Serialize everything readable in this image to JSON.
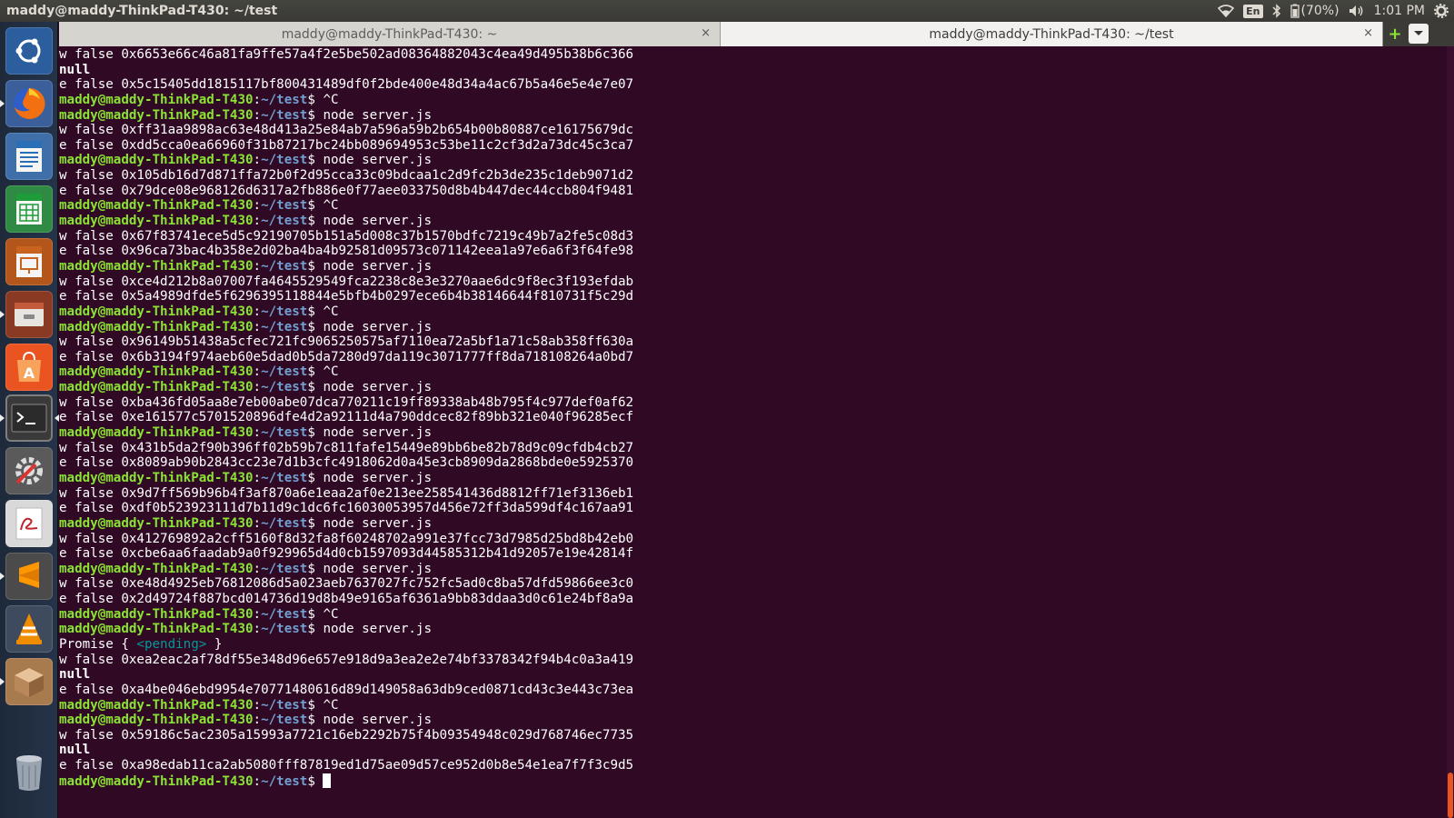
{
  "panel": {
    "title": "maddy@maddy-ThinkPad-T430: ~/test",
    "lang": "En",
    "battery": "(70%)",
    "time": "1:01 PM"
  },
  "tabs": [
    {
      "label": "maddy@maddy-ThinkPad-T430: ~",
      "close": "×"
    },
    {
      "label": "maddy@maddy-ThinkPad-T430: ~/test",
      "close": "×"
    }
  ],
  "prompt": {
    "user": "maddy@maddy-ThinkPad-T430",
    "path": "~/test",
    "symbol": "$"
  },
  "terminal_lines": [
    {
      "type": "out",
      "text": "w false 0x6653e66c46a81fa9ffe57a4f2e5be502ad08364882043c4ea49d495b38b6c366"
    },
    {
      "type": "bold",
      "text": "null"
    },
    {
      "type": "out",
      "text": "e false 0x5c15405dd1815117bf800431489df0f2bde400e48d34a4ac67b5a46e5e4e7e07"
    },
    {
      "type": "prompt",
      "cmd": "^C"
    },
    {
      "type": "prompt",
      "cmd": "node server.js"
    },
    {
      "type": "out",
      "text": "w false 0xff31aa9898ac63e48d413a25e84ab7a596a59b2b654b00b80887ce16175679dc"
    },
    {
      "type": "out",
      "text": "e false 0xdd5cca0ea66960f31b87217bc24bb089694953c53be11c2cf3d2a73dc45c3ca7"
    },
    {
      "type": "prompt",
      "cmd": "node server.js"
    },
    {
      "type": "out",
      "text": "w false 0x105db16d7d871ffa72b0f2d95cca33c09bdcaa1c2d9fc2b3de235c1deb9071d2"
    },
    {
      "type": "out",
      "text": "e false 0x79dce08e968126d6317a2fb886e0f77aee033750d8b4b447dec44ccb804f9481"
    },
    {
      "type": "prompt",
      "cmd": "^C"
    },
    {
      "type": "prompt",
      "cmd": "node server.js"
    },
    {
      "type": "out",
      "text": "w false 0x67f83741ece5d5c92190705b151a5d008c37b1570bdfc7219c49b7a2fe5c08d3"
    },
    {
      "type": "out",
      "text": "e false 0x96ca73bac4b358e2d02ba4ba4b92581d09573c071142eea1a97e6a6f3f64fe98"
    },
    {
      "type": "prompt",
      "cmd": "node server.js"
    },
    {
      "type": "out",
      "text": "w false 0xce4d212b8a07007fa4645529549fca2238c8e3e3270aae6dc9f8ec3f193efdab"
    },
    {
      "type": "out",
      "text": "e false 0x5a4989dfde5f6296395118844e5bfb4b0297ece6b4b38146644f810731f5c29d"
    },
    {
      "type": "prompt",
      "cmd": "^C"
    },
    {
      "type": "prompt",
      "cmd": "node server.js"
    },
    {
      "type": "out",
      "text": "w false 0x96149b51438a5cfec721fc9065250575af7110ea72a5bf1a71c58ab358ff630a"
    },
    {
      "type": "out",
      "text": "e false 0x6b3194f974aeb60e5dad0b5da7280d97da119c3071777ff8da718108264a0bd7"
    },
    {
      "type": "prompt",
      "cmd": "^C"
    },
    {
      "type": "prompt",
      "cmd": "node server.js"
    },
    {
      "type": "out",
      "text": "w false 0xba436fd05aa8e7eb00abe07dca770211c19ff89338ab48b795f4c977def0af62"
    },
    {
      "type": "out",
      "text": "e false 0xe161577c5701520896dfe4d2a92111d4a790ddcec82f89bb321e040f96285ecf"
    },
    {
      "type": "prompt",
      "cmd": "node server.js"
    },
    {
      "type": "out",
      "text": "w false 0x431b5da2f90b396ff02b59b7c811fafe15449e89bb6be82b78d9c09cfdb4cb27"
    },
    {
      "type": "out",
      "text": "e false 0x8089ab90b2843cc23e7d1b3cfc4918062d0a45e3cb8909da2868bde0e5925370"
    },
    {
      "type": "prompt",
      "cmd": "node server.js"
    },
    {
      "type": "out",
      "text": "w false 0x9d7ff569b96b4f3af870a6e1eaa2af0e213ee258541436d8812ff71ef3136eb1"
    },
    {
      "type": "out",
      "text": "e false 0xdf0b523923111d7b11d9c1dc6fc16030053957d456e72ff3da599df4c167aa91"
    },
    {
      "type": "prompt",
      "cmd": "node server.js"
    },
    {
      "type": "out",
      "text": "w false 0x412769892a2cff5160f8d32fa8f60248702a991e37fcc73d7985d25bd8b42eb0"
    },
    {
      "type": "out",
      "text": "e false 0xcbe6aa6faadab9a0f929965d4d0cb1597093d44585312b41d92057e19e42814f"
    },
    {
      "type": "prompt",
      "cmd": "node server.js"
    },
    {
      "type": "out",
      "text": "w false 0xe48d4925eb76812086d5a023aeb7637027fc752fc5ad0c8ba57dfd59866ee3c0"
    },
    {
      "type": "out",
      "text": "e false 0x2d49724f887bcd014736d19d8b49e9165af6361a9bb83ddaa3d0c61e24bf8a9a"
    },
    {
      "type": "prompt",
      "cmd": "^C"
    },
    {
      "type": "prompt",
      "cmd": "node server.js"
    },
    {
      "type": "promise",
      "pre": "Promise { ",
      "pending": "<pending>",
      "post": " }"
    },
    {
      "type": "out",
      "text": "w false 0xea2eac2af78df55e348d96e657e918d9a3ea2e2e74bf3378342f94b4c0a3a419"
    },
    {
      "type": "bold",
      "text": "null"
    },
    {
      "type": "out",
      "text": "e false 0xa4be046ebd9954e70771480616d89d149058a63db9ced0871cd43c3e443c73ea"
    },
    {
      "type": "prompt",
      "cmd": "^C"
    },
    {
      "type": "prompt",
      "cmd": "node server.js"
    },
    {
      "type": "out",
      "text": "w false 0x59186c5ac2305a15993a7721c16eb2292b75f4b09354948c029d768746ec7735"
    },
    {
      "type": "bold",
      "text": "null"
    },
    {
      "type": "out",
      "text": "e false 0xa98edab11ca2ab5080fff87819ed1d75ae09d57ce952d0b8e54e1ea7f7f3c9d5"
    },
    {
      "type": "prompt",
      "cmd": "",
      "cursor": true
    }
  ],
  "launcher_icons": [
    {
      "name": "ubuntu-dash-icon",
      "color": "#2c5e9e"
    },
    {
      "name": "firefox-icon",
      "color": "#e66000"
    },
    {
      "name": "libreoffice-writer-icon",
      "color": "#2a6fb5"
    },
    {
      "name": "libreoffice-calc-icon",
      "color": "#1f9b3a"
    },
    {
      "name": "libreoffice-impress-icon",
      "color": "#c8641e"
    },
    {
      "name": "files-icon",
      "color": "#8a6d4a"
    },
    {
      "name": "software-center-icon",
      "color": "#e95420"
    },
    {
      "name": "terminal-icon",
      "color": "#2e2e2e"
    },
    {
      "name": "system-settings-icon",
      "color": "#5f5f5f"
    },
    {
      "name": "document-viewer-icon",
      "color": "#d9d9d9"
    },
    {
      "name": "sublime-text-icon",
      "color": "#4b4b4b"
    },
    {
      "name": "vlc-icon",
      "color": "#f08c00"
    },
    {
      "name": "package-icon",
      "color": "#a87b4f"
    },
    {
      "name": "trash-icon",
      "color": "#6b7380"
    }
  ]
}
